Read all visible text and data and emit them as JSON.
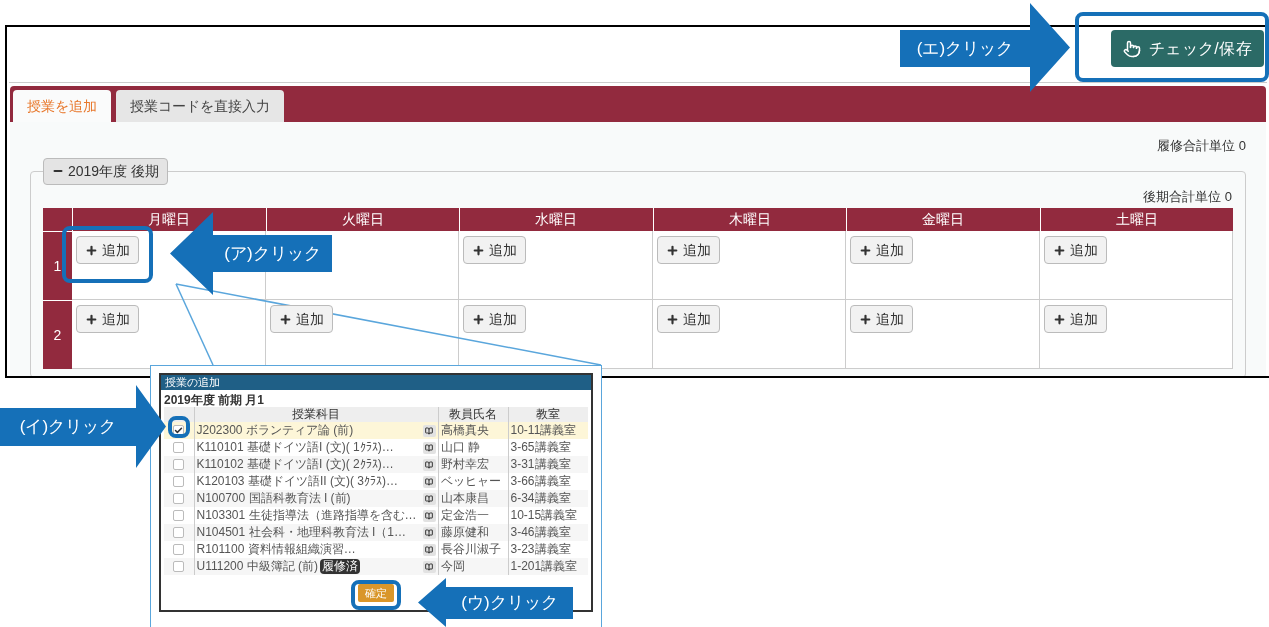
{
  "app": {
    "save_button": "チェック/保存",
    "tabs": [
      {
        "label": "授業を追加",
        "selected": true
      },
      {
        "label": "授業コードを直接入力",
        "selected": false
      }
    ],
    "total_credits": "履修合計単位 0",
    "term": {
      "legend": "2019年度 後期",
      "expanded": true,
      "credits": "後期合計単位 0"
    },
    "days": [
      "月曜日",
      "火曜日",
      "水曜日",
      "木曜日",
      "金曜日",
      "土曜日"
    ],
    "periods": [
      {
        "label": "1",
        "slots": [
          {
            "kind": "add",
            "label": "追加"
          },
          {
            "kind": "empty"
          },
          {
            "kind": "add",
            "label": "追加"
          },
          {
            "kind": "add",
            "label": "追加"
          },
          {
            "kind": "add",
            "label": "追加"
          },
          {
            "kind": "add",
            "label": "追加"
          }
        ]
      },
      {
        "label": "2",
        "slots": [
          {
            "kind": "add",
            "label": "追加"
          },
          {
            "kind": "add",
            "label": "追加"
          },
          {
            "kind": "add",
            "label": "追加"
          },
          {
            "kind": "add",
            "label": "追加"
          },
          {
            "kind": "add",
            "label": "追加"
          },
          {
            "kind": "add",
            "label": "追加"
          }
        ]
      }
    ]
  },
  "dialog": {
    "title": "授業の追加",
    "heading": "2019年度 前期 月1",
    "columns": [
      "授業科目",
      "教員氏名",
      "教室"
    ],
    "rows": [
      {
        "subject": "J202300 ボランティア論 (前)",
        "teacher": "高橋真央",
        "room": "10-11講義室",
        "checked": true
      },
      {
        "subject": "K110101 基礎ドイツ語I (文)( 1ｸﾗｽ)…",
        "teacher": "山口 静",
        "room": "3-65講義室",
        "checked": false
      },
      {
        "subject": "K110102 基礎ドイツ語I (文)( 2ｸﾗｽ)…",
        "teacher": "野村幸宏",
        "room": "3-31講義室",
        "checked": false
      },
      {
        "subject": "K120103 基礎ドイツ語II (文)( 3ｸﾗｽ)…",
        "teacher": "ベッヒャー",
        "room": "3-66講義室",
        "checked": false
      },
      {
        "subject": "N100700 国語科教育法 I (前)",
        "teacher": "山本康昌",
        "room": "6-34講義室",
        "checked": false
      },
      {
        "subject": "N103301 生徒指導法（進路指導を含む…",
        "teacher": "定金浩一",
        "room": "10-15講義室",
        "checked": false
      },
      {
        "subject": "N104501 社会科・地理科教育法 I（1…",
        "teacher": "藤原健和",
        "room": "3-46講義室",
        "checked": false
      },
      {
        "subject": "R101100 資料情報組織演習…",
        "teacher": "長谷川淑子",
        "room": "3-23講義室",
        "checked": false
      },
      {
        "subject": "U111200 中級簿記 (前)",
        "badge": "履修済",
        "teacher": "今岡",
        "room": "1-201講義室",
        "checked": false
      }
    ],
    "confirm_button": "確定"
  },
  "annotations": [
    {
      "label": "(エ)クリック",
      "kind": "right"
    },
    {
      "label": "(ア)クリック",
      "kind": "left"
    },
    {
      "label": "(イ)クリック",
      "kind": "right"
    },
    {
      "label": "(ウ)クリック",
      "kind": "left"
    }
  ]
}
